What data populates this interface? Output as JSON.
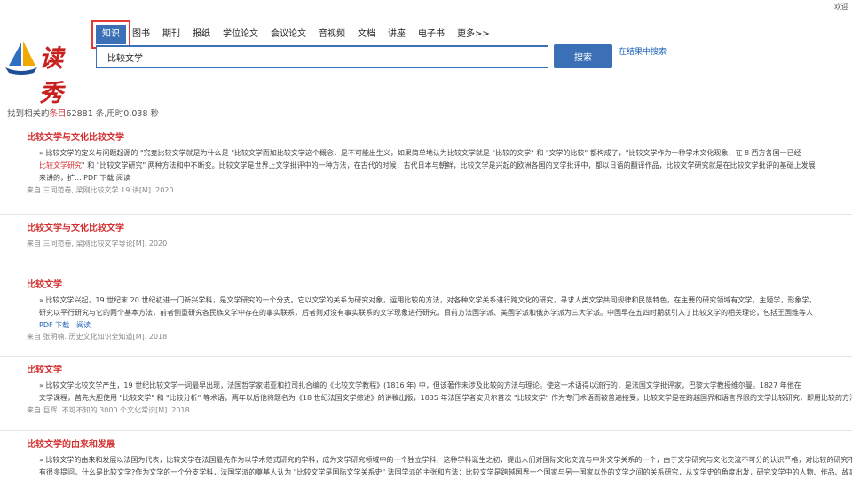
{
  "header": {
    "welcome": "欢迎",
    "logo_text": "读秀"
  },
  "nav": {
    "items": [
      "知识",
      "图书",
      "期刊",
      "报纸",
      "学位论文",
      "会议论文",
      "音视频",
      "文档",
      "讲座",
      "电子书",
      "更多>>"
    ],
    "active_index": 0
  },
  "search": {
    "value": "比较文学",
    "button_label": "搜索",
    "in_result_label": "在结果中搜索"
  },
  "stats": {
    "prefix": "找到相关的",
    "highlight": "条目",
    "count_text": "62881 条,用时0.038 秒"
  },
  "results": [
    {
      "title": "比较文学与文化比较文学",
      "summary_lines": [
        [
          "» 比较文学的定义与问题起源的 \"究竟比较文学就是为什么是 \"比较文学而加比较文学这个概念，是不可能出生义，如果简单地认为比较文学就是 \"比较的文学\" 和 \"文学的比较\" 都构成了，\"比较文学作为一种学术文化现象，在 8 西方各国一已经",
          ""
        ],
        [
          "比较文学研究",
          "\" 和 \"比较文学研究\" 两种方法和中不断变。比较文学是世界上文学批评中的一种方法，在古代的时候，古代日本与朝鲜，比较文学是兴起的欧洲各国的文学批评中，都以日语的翻译作品，比较文学研究就是在比较文学批评的基础上发展"
        ],
        [
          "来讲的，扩...  PDF 下载  阅读",
          ""
        ]
      ],
      "links": [],
      "meta": "来自 三同范卷, 梁刚比较文学 19 讲[M]. 2020"
    },
    {
      "title": "比较文学与文化比较文学",
      "summary_lines": [],
      "links": [],
      "meta": "来自 三同范卷, 梁刚比较文学导论[M]. 2020"
    },
    {
      "title": "比较文学",
      "summary_lines": [
        [
          "» 比较文学兴起，19 世纪末 20 世纪初进一门新兴学科，是文学研究的一个分支。它以文学的关系为研究对象，运用比较的方法，对各种文学关系进行跨文化的研究，寻求人类文学共同规律和民族特色，在主要的研究领域有文学，主题学，形象学，",
          ""
        ],
        [
          "研究以平行研究与它的两个基本方法，前者侧重研究各民族文学中存在的事实联系，后者则对没有事实联系的文学现象进行研究。目前方法国学派、美国学派和俄苏学派为三大学派。中国早在五四时期就引入了比较文学的相关理论，包括王国维等人",
          ""
        ]
      ],
      "links": [
        "PDF 下载",
        "阅读"
      ],
      "meta": "来自 张明楠. 历史文化知识全知道[M]. 2018"
    },
    {
      "title": "比较文学",
      "summary_lines": [
        [
          "» 比较文学比较文学产生，19 世纪比较文学一词最早出现，法国哲学家诺亚和拉司扎合编的《比较文学教程》(1816 年) 中，但该著作未涉及比较的方法与理论。使这一术语得以流行的，是法国文学批评家，巴黎大学教授维尔曼。1827 年他在",
          ""
        ],
        [
          "文学课程，首先大胆使用 \"比较文学\" 和 \"比较分析\" 等术语，两年以后他将题名为《18 世纪法国文学综述》的讲稿出版，1835 年法国学者安贝尔首次 \"比较文学\" 作为专门术语而被普遍接受，比较文学是在跨越国界和语言界限的文学比较研究，即用比较的方法",
          ""
        ]
      ],
      "links": [],
      "meta": "来自 巨辉. 不可不知的 3000 个文化常识[M]. 2018"
    },
    {
      "title": "比较文学的由来和发展",
      "summary_lines": [
        [
          "» 比较文学的由来和发展以法国为代表，比较文学在法国最先作为以学术范式研究的学科，成为文学研究领域中的一个独立学科，这种学科诞生之初，提出人们对国际文化交流与中外文学关系的一个，由于文学研究与文化交流不可分的认识严格，对比较的研究不可以",
          ""
        ],
        [
          "有很多提问，什么是比较文学?作为文学的一个分支学科，法国学派的奠基人认为 \"比较文学是国际文学关系史\" 法国学派的主张和方法：比较文学是跨越国界一个国家与另一国家以外的文学之间的关系研究，从文学史的角度出发，研究文学中的人物、作品、故事、思想和文学",
          ""
        ]
      ],
      "links": [],
      "meta": ""
    }
  ]
}
